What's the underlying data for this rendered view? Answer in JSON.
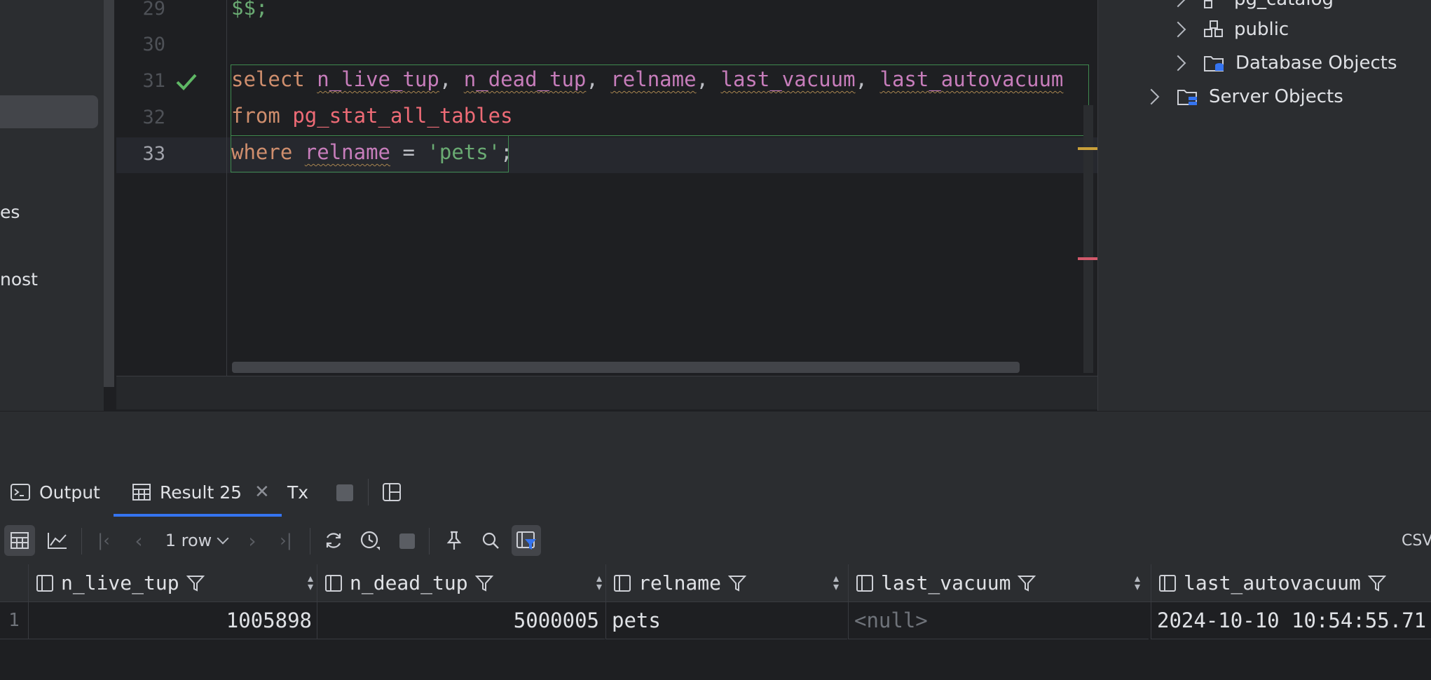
{
  "left_panel": {
    "partial_items": [
      "es",
      "nost"
    ]
  },
  "editor": {
    "lines": [
      {
        "number": "29",
        "text": "$$;"
      },
      {
        "number": "30",
        "text": ""
      },
      {
        "number": "31"
      },
      {
        "number": "32"
      },
      {
        "number": "33"
      }
    ],
    "sql": {
      "select_kw": "select",
      "col1": "n_live_tup",
      "col2": "n_dead_tup",
      "col3": "relname",
      "col4": "last_vacuum",
      "col5": "last_autovacuum",
      "comma": ",",
      "from_kw": "from",
      "table": "pg_stat_all_tables",
      "where_kw": "where",
      "where_col": "relname",
      "op": "=",
      "value": "'pets'",
      "semicolon": ";"
    },
    "colors": {
      "keyword": "#cf8e6d",
      "column": "#c77dbb",
      "table": "#ee6b76",
      "string": "#6aab73"
    }
  },
  "schema_tree": {
    "items": [
      {
        "label": "pg_catalog",
        "icon": "schema-icon"
      },
      {
        "label": "public",
        "icon": "schema-icon"
      },
      {
        "label": "Database Objects",
        "icon": "folder-database-icon"
      },
      {
        "label": "Server Objects",
        "icon": "folder-server-icon"
      }
    ]
  },
  "tabs": {
    "output": "Output",
    "result": "Result 25",
    "tx": "Tx",
    "active": "Result 25"
  },
  "toolbar": {
    "row_count": "1 row",
    "export_label": "CSV"
  },
  "grid": {
    "columns": [
      "n_live_tup",
      "n_dead_tup",
      "relname",
      "last_vacuum",
      "last_autovacuum"
    ],
    "row_number": "1",
    "row": {
      "n_live_tup": "1005898",
      "n_dead_tup": "5000005",
      "relname": "pets",
      "last_vacuum": "<null>",
      "last_autovacuum": "2024-10-10 10:54:55.71"
    }
  }
}
